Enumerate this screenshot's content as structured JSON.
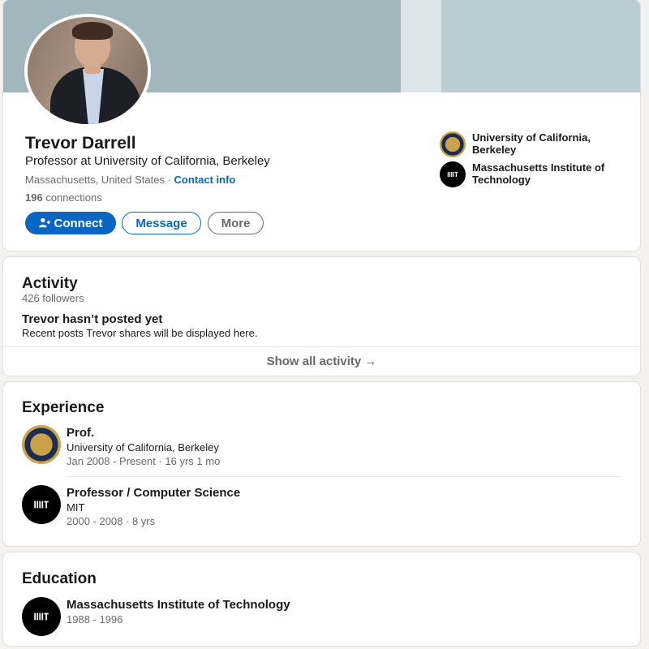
{
  "profile": {
    "name": "Trevor Darrell",
    "headline": "Professor at University of California, Berkeley",
    "location": "Massachusetts, United States",
    "separator": " · ",
    "contact_info": "Contact info",
    "connections_count": "196",
    "connections_label": " connections",
    "buttons": {
      "connect": "Connect",
      "message": "Message",
      "more": "More"
    },
    "organizations": [
      {
        "name": "University of California, Berkeley",
        "logo": "uc-seal-icon"
      },
      {
        "name": "Massachusetts Institute of Technology",
        "logo": "mit-logo-icon"
      }
    ]
  },
  "activity": {
    "title": "Activity",
    "followers": "426 followers",
    "empty_title": "Trevor hasn’t posted yet",
    "empty_subtitle": "Recent posts Trevor shares will be displayed here.",
    "show_all": "Show all activity →"
  },
  "experience": {
    "title": "Experience",
    "items": [
      {
        "title": "Prof.",
        "company": "University of California, Berkeley",
        "dates": "Jan 2008 - Present · 16 yrs 1 mo",
        "logo": "uc-seal-icon"
      },
      {
        "title": "Professor / Computer Science",
        "company": "MIT",
        "dates": "2000 - 2008 · 8 yrs",
        "logo": "mit-logo-icon"
      }
    ]
  },
  "education": {
    "title": "Education",
    "items": [
      {
        "school": "Massachusetts Institute of Technology",
        "dates": "1988 - 1996",
        "logo": "mit-logo-icon"
      }
    ]
  },
  "colors": {
    "primary": "#0a66c2",
    "background": "#f4f2ee",
    "banner": "#a2b6bd"
  }
}
